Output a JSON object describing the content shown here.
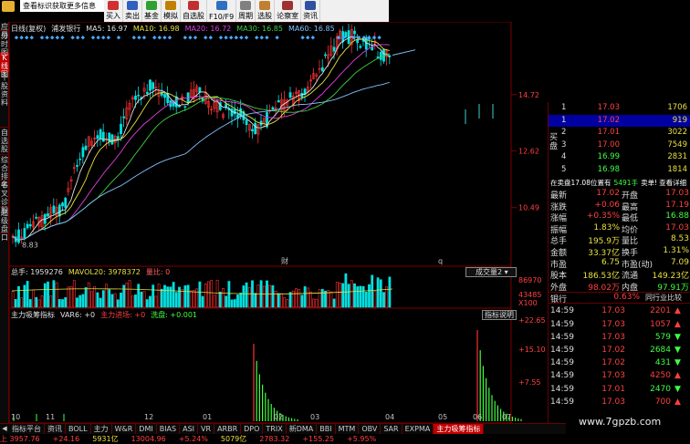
{
  "notice": "查看标识获取更多信息",
  "toolbar": [
    {
      "label": "买入",
      "color": "#d03030"
    },
    {
      "label": "卖出",
      "color": "#3060c0"
    },
    {
      "label": "基金",
      "color": "#30a030"
    },
    {
      "label": "模拟",
      "color": "#c08000"
    },
    {
      "label": "自选股",
      "color": "#c03030"
    },
    {
      "label": "F10/F9",
      "color": "#3070c0"
    },
    {
      "label": "周期",
      "color": "#808080"
    },
    {
      "label": "选股",
      "color": "#c08030"
    },
    {
      "label": "论察室",
      "color": "#a03030"
    },
    {
      "label": "资讯",
      "color": "#3050a0"
    }
  ],
  "left_tabs": [
    {
      "label": "应用",
      "active": false
    },
    {
      "label": "分时图",
      "active": false
    },
    {
      "label": "K线图",
      "active": true
    },
    {
      "label": "个股资料",
      "active": false
    },
    {
      "label": "自选股",
      "active": false
    },
    {
      "label": "综合排名",
      "active": false
    },
    {
      "label": "牛叉诊股",
      "active": false
    },
    {
      "label": "超级盘口",
      "active": false
    }
  ],
  "price_panel": {
    "header": [
      {
        "text": "日线(复权)",
        "color": "#e0e0e0"
      },
      {
        "text": "浦发银行",
        "color": "#e0e0e0"
      },
      {
        "text": "MA5: 16.97",
        "color": "#e0e0e0"
      },
      {
        "text": "MA10: 16.98",
        "color": "#e8e040"
      },
      {
        "text": "MA20: 16.72",
        "color": "#e040e0"
      },
      {
        "text": "MA30: 16.85",
        "color": "#40d040"
      },
      {
        "text": "MA60: 16.85",
        "color": "#80c0ff"
      }
    ],
    "y_labels": [
      "14.72",
      "12.62",
      "10.49"
    ],
    "low_label": "8.83",
    "markers": [
      "财",
      "q"
    ]
  },
  "volume_panel": {
    "header": [
      {
        "text": "总手: 1959276",
        "color": "#e0e0e0"
      },
      {
        "text": "MAVOL20: 3978372",
        "color": "#e8e040"
      },
      {
        "text": "量比: 0",
        "color": "#ff6060"
      }
    ],
    "button": "成交量2",
    "y_labels": [
      "86970",
      "43485",
      "X100"
    ]
  },
  "indicator_panel": {
    "header": [
      {
        "text": "主力吸筹指标",
        "color": "#e0e0e0"
      },
      {
        "text": "VAR6: +0",
        "color": "#e0e0e0"
      },
      {
        "text": "主力进场: +0",
        "color": "#ff4040"
      },
      {
        "text": "洗盘: +0.001",
        "color": "#40ff40"
      }
    ],
    "button": "指标说明",
    "y_labels": [
      "+22.65",
      "+15.10",
      "+7.55"
    ]
  },
  "x_axis": [
    "10",
    "11",
    "12",
    "01",
    "02",
    "03",
    "04",
    "05",
    "06",
    "07"
  ],
  "order_book": {
    "sell_label": "卖盘",
    "buy_label": "买盘",
    "sell": [
      {
        "level": "1",
        "price": "17.03",
        "vol": "1706"
      },
      {
        "level": "1",
        "price": "17.02",
        "vol": "919"
      }
    ],
    "buy": [
      {
        "level": "2",
        "price": "17.01",
        "vol": "3022"
      },
      {
        "level": "3",
        "price": "17.00",
        "vol": "7549"
      },
      {
        "level": "4",
        "price": "16.99",
        "vol": "2831"
      },
      {
        "level": "5",
        "price": "16.98",
        "vol": "1814"
      }
    ],
    "notice": "在卖盘17.08位置有",
    "notice2": "5491手",
    "notice3": "卖单!",
    "notice4": "查看详细"
  },
  "stats": [
    {
      "l1": "最新",
      "v1": "17.02",
      "c1": "#ff4040",
      "l2": "开盘",
      "v2": "17.03",
      "c2": "#ff4040"
    },
    {
      "l1": "涨跌",
      "v1": "+0.06",
      "c1": "#ff4040",
      "l2": "最高",
      "v2": "17.19",
      "c2": "#ff4040"
    },
    {
      "l1": "涨幅",
      "v1": "+0.35%",
      "c1": "#ff4040",
      "l2": "最低",
      "v2": "16.88",
      "c2": "#40ff40"
    },
    {
      "l1": "振幅",
      "v1": "1.83%",
      "c1": "#e8e040",
      "l2": "均价",
      "v2": "17.03",
      "c2": "#ff4040"
    },
    {
      "l1": "总手",
      "v1": "195.9万",
      "c1": "#e8e040",
      "l2": "量比",
      "v2": "8.53",
      "c2": "#e8e040"
    },
    {
      "l1": "金额",
      "v1": "33.37亿",
      "c1": "#e8e040",
      "l2": "换手",
      "v2": "1.31%",
      "c2": "#e8e040"
    },
    {
      "l1": "市盈",
      "v1": "6.75",
      "c1": "#e8e040",
      "l2": "市盈(动)",
      "v2": "7.09",
      "c2": "#e8e040"
    },
    {
      "l1": "股本",
      "v1": "186.53亿",
      "c1": "#e8e040",
      "l2": "流通",
      "v2": "149.23亿",
      "c2": "#e8e040"
    },
    {
      "l1": "外盘",
      "v1": "98.02万",
      "c1": "#ff4040",
      "l2": "内盘",
      "v2": "97.91万",
      "c2": "#40ff40"
    }
  ],
  "sector": {
    "name": "银行",
    "pct": "0.63%",
    "button": "同行业比较"
  },
  "ticks": [
    {
      "time": "14:59",
      "price": "17.03",
      "vol": "2201",
      "arrow": "▲",
      "color": "#ff4040"
    },
    {
      "time": "14:59",
      "price": "17.03",
      "vol": "1057",
      "arrow": "▲",
      "color": "#ff4040"
    },
    {
      "time": "14:59",
      "price": "17.03",
      "vol": "579",
      "arrow": "▼",
      "color": "#40ff40"
    },
    {
      "time": "14:59",
      "price": "17.02",
      "vol": "2684",
      "arrow": "▼",
      "color": "#40ff40"
    },
    {
      "time": "14:59",
      "price": "17.02",
      "vol": "431",
      "arrow": "▼",
      "color": "#40ff40"
    },
    {
      "time": "14:59",
      "price": "17.03",
      "vol": "4250",
      "arrow": "▲",
      "color": "#ff4040"
    },
    {
      "time": "14:59",
      "price": "17.01",
      "vol": "2470",
      "arrow": "▼",
      "color": "#40ff40"
    },
    {
      "time": "14:59",
      "price": "17.03",
      "vol": "700",
      "arrow": "▲",
      "color": "#ff4040"
    }
  ],
  "bottom_tabs": [
    {
      "label": "指标平台",
      "active": false
    },
    {
      "label": "资讯",
      "active": false
    },
    {
      "label": "BOLL",
      "active": false
    },
    {
      "label": "主力",
      "active": false
    },
    {
      "label": "W&R",
      "active": false
    },
    {
      "label": "DMI",
      "active": false
    },
    {
      "label": "BIAS",
      "active": false
    },
    {
      "label": "ASI",
      "active": false
    },
    {
      "label": "VR",
      "active": false
    },
    {
      "label": "ARBR",
      "active": false
    },
    {
      "label": "DPO",
      "active": false
    },
    {
      "label": "TRIX",
      "active": false
    },
    {
      "label": "新DMA",
      "active": false
    },
    {
      "label": "BBI",
      "active": false
    },
    {
      "label": "MTM",
      "active": false
    },
    {
      "label": "OBV",
      "active": false
    },
    {
      "label": "SAR",
      "active": false
    },
    {
      "label": "EXPMA",
      "active": false
    },
    {
      "label": "主力吸筹指标",
      "active": true
    }
  ],
  "ticker": [
    {
      "text": "上 3957.76",
      "color": "#ff4040"
    },
    {
      "text": "+24.16",
      "color": "#ff4040"
    },
    {
      "text": "5931亿",
      "color": "#e8e040"
    },
    {
      "text": "13004.96",
      "color": "#ff4040"
    },
    {
      "text": "+5.24%",
      "color": "#ff4040"
    },
    {
      "text": "5079亿",
      "color": "#e8e040"
    },
    {
      "text": "2783.32",
      "color": "#ff4040"
    },
    {
      "text": "+155.25",
      "color": "#ff4040"
    },
    {
      "text": "+5.95%",
      "color": "#ff4040"
    }
  ],
  "watermark": "www.7gpzb.com"
}
